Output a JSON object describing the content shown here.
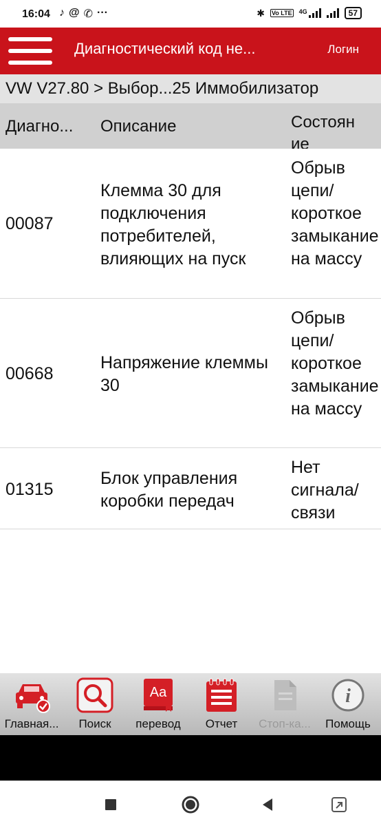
{
  "status_bar": {
    "time": "16:04",
    "left_icons": [
      "tiktok-icon",
      "at-icon",
      "whatsapp-icon",
      "more-dots-icon"
    ],
    "network": "4G",
    "volte": "Vo LTE",
    "battery": "57"
  },
  "app_bar": {
    "title": "Диагностический код не...",
    "login": "Логин"
  },
  "breadcrumb": "VW V27.80 > Выбор...25 Иммобилизатор",
  "table": {
    "headers": {
      "code": "Диагно...",
      "description": "Описание",
      "state": "Состоян ие"
    },
    "rows": [
      {
        "code": "00087",
        "description": "Клемма 30 для подключения потребителей, влияющих на пуск",
        "state": "Обрыв цепи/ короткое замыкание на массу"
      },
      {
        "code": "00668",
        "description": "Напряжение клеммы 30",
        "state": "Обрыв цепи/ короткое замыкание на массу"
      },
      {
        "code": "01315",
        "description": "Блок управления коробки передач",
        "state": "Нет сигнала/ связи"
      }
    ]
  },
  "toolbar": {
    "items": [
      {
        "label": "Главная...",
        "icon": "car-home-icon",
        "enabled": true
      },
      {
        "label": "Поиск",
        "icon": "search-icon",
        "enabled": true
      },
      {
        "label": "перевод",
        "icon": "translate-book-icon",
        "enabled": true
      },
      {
        "label": "Отчет",
        "icon": "report-notepad-icon",
        "enabled": true
      },
      {
        "label": "Стоп-ка...",
        "icon": "document-icon",
        "enabled": false
      },
      {
        "label": "Помощь",
        "icon": "info-icon",
        "enabled": true
      }
    ]
  },
  "colors": {
    "accent": "#c9131b",
    "toolbar_bg": "#c8c8c8",
    "header_bg": "#d0d0d0"
  }
}
